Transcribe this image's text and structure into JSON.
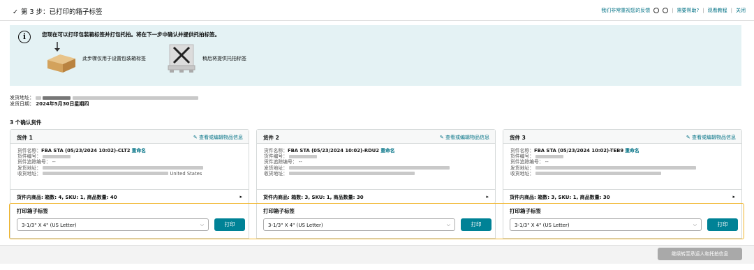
{
  "header": {
    "check": "✓",
    "step_title": "第 3 步：已打印的箱子标签",
    "feedback": "我们非常重视您的反馈",
    "help": "需要帮助?",
    "tutorial": "观看教程",
    "close": "关闭",
    "separator": "|"
  },
  "banner": {
    "info_glyph": "i",
    "message": "您现在可以打印包装箱标签并打包托拍。将在下一步中确认并提供托拍标签。",
    "box_caption": "此步骤仅用于设置包装箱标签",
    "pallet_caption": "稍后将提供托拍标签"
  },
  "addresses": {
    "ship_from_label": "发货地址：",
    "ship_date_label": "发货日期：",
    "ship_date": "2024年5月30日星期四"
  },
  "shipments_count": "3 个确认货件",
  "fields": {
    "name": "货件名称：",
    "id": "货件编号：",
    "tracking": "货件追踪编号：",
    "from": "发货地址：",
    "to": "收货地址：",
    "rename": "重命名",
    "edit_link": "查看或编辑物品信息",
    "print_label": "打印箱子标签",
    "print_button": "打印",
    "arrow": "▸",
    "chevron": "⌵",
    "pencil": "✎"
  },
  "cards": [
    {
      "title": "货件 1",
      "name": "FBA STA (05/23/2024 10:02)-CLT2",
      "tracking": "--",
      "to_tail": "United States",
      "contents": "货件内商品: 箱数: 4, SKU: 1, 商品数量: 40",
      "select_value": "3-1/3\" X 4\" (US Letter)"
    },
    {
      "title": "货件 2",
      "name": "FBA STA (05/23/2024 10:02)-RDU2",
      "tracking": "--",
      "to_tail": "",
      "contents": "货件内商品: 箱数: 3, SKU: 1, 商品数量: 30",
      "select_value": "3-1/3\" X 4\" (US Letter)"
    },
    {
      "title": "货件 3",
      "name": "FBA STA (05/23/2024 10:02)-TEB9",
      "tracking": "--",
      "to_tail": "",
      "contents": "货件内商品: 箱数: 3, SKU: 1, 商品数量: 30",
      "select_value": "3-1/3\" X 4\" (US Letter)"
    }
  ],
  "footer": {
    "continue": "继续转至承运人和托拍信息"
  },
  "colors": {
    "accent": "#008296",
    "link": "#007185",
    "highlight": "#f0b429",
    "banner": "#e4f2f4"
  }
}
